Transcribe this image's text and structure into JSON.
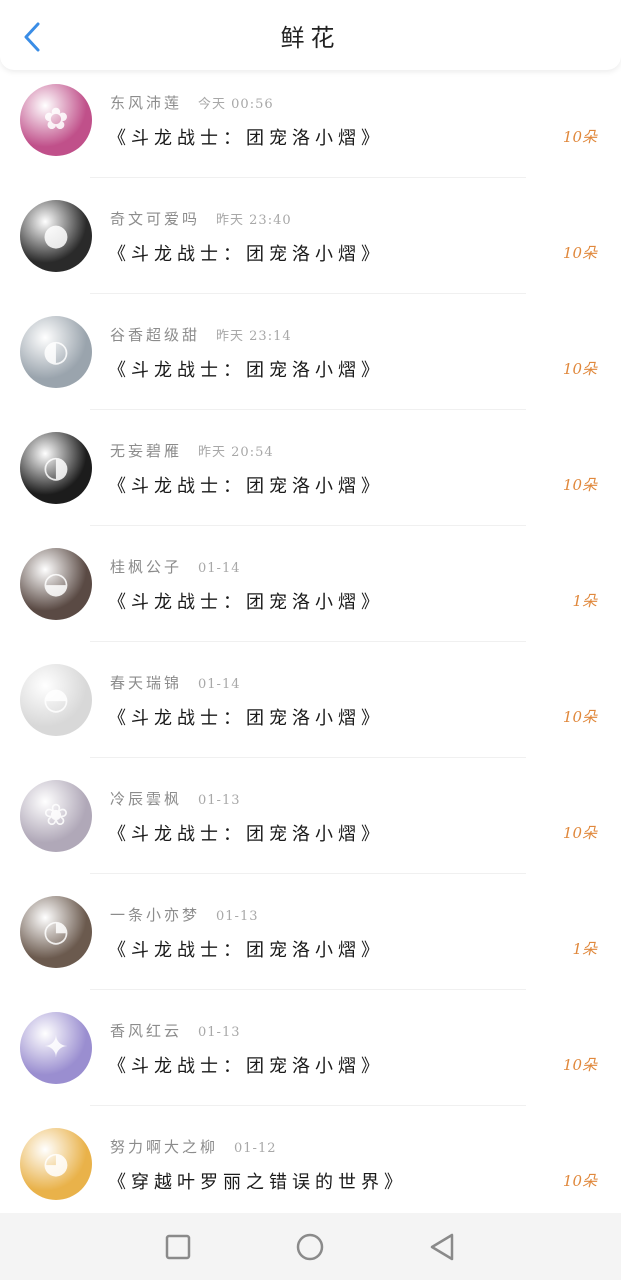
{
  "header": {
    "title": "鲜花",
    "back_icon": "chevron-left-icon"
  },
  "items": [
    {
      "user": "东风沛莲",
      "time": "今天 00:56",
      "book": "《斗龙战士：团宠洛小熠》",
      "count": "10朵",
      "avatar_color": "#c0508a",
      "avatar_glyph": "✿"
    },
    {
      "user": "奇文可爱吗",
      "time": "昨天 23:40",
      "book": "《斗龙战士：团宠洛小熠》",
      "count": "10朵",
      "avatar_color": "#2a2a2a",
      "avatar_glyph": "●"
    },
    {
      "user": "谷香超级甜",
      "time": "昨天 23:14",
      "book": "《斗龙战士：团宠洛小熠》",
      "count": "10朵",
      "avatar_color": "#9aa4ad",
      "avatar_glyph": "◐"
    },
    {
      "user": "无妄碧雁",
      "time": "昨天 20:54",
      "book": "《斗龙战士：团宠洛小熠》",
      "count": "10朵",
      "avatar_color": "#1c1c1c",
      "avatar_glyph": "◑"
    },
    {
      "user": "桂枫公子",
      "time": "01-14",
      "book": "《斗龙战士：团宠洛小熠》",
      "count": "1朵",
      "avatar_color": "#5a4a44",
      "avatar_glyph": "◒"
    },
    {
      "user": "春天瑞锦",
      "time": "01-14",
      "book": "《斗龙战士：团宠洛小熠》",
      "count": "10朵",
      "avatar_color": "#d8d8d8",
      "avatar_glyph": "◓"
    },
    {
      "user": "冷辰雲枫",
      "time": "01-13",
      "book": "《斗龙战士：团宠洛小熠》",
      "count": "10朵",
      "avatar_color": "#b0a8b8",
      "avatar_glyph": "❀"
    },
    {
      "user": "一条小亦梦",
      "time": "01-13",
      "book": "《斗龙战士：团宠洛小熠》",
      "count": "1朵",
      "avatar_color": "#6b5a4e",
      "avatar_glyph": "◔"
    },
    {
      "user": "香风红云",
      "time": "01-13",
      "book": "《斗龙战士：团宠洛小熠》",
      "count": "10朵",
      "avatar_color": "#9a8ed0",
      "avatar_glyph": "✦"
    },
    {
      "user": "努力啊大之柳",
      "time": "01-12",
      "book": "《穿越叶罗丽之错误的世界》",
      "count": "10朵",
      "avatar_color": "#e9b24a",
      "avatar_glyph": "◕"
    }
  ],
  "navbar": {
    "buttons": [
      "square-icon",
      "circle-icon",
      "triangle-back-icon"
    ]
  }
}
